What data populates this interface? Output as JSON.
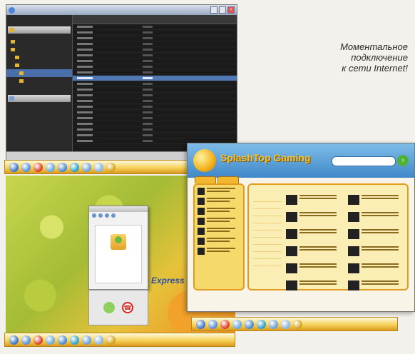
{
  "tagline": {
    "line1": "Моментальное",
    "line2": "подключение",
    "line3": "к сети Internet!"
  },
  "games": {
    "title": "SplashTop Gaming"
  },
  "desktop": {
    "brand_text": "Express G"
  },
  "dock_icon_colors": [
    "#3a76c9",
    "#5a8fd8",
    "#d8402a",
    "#6aa8e0",
    "#4b87cf",
    "#2fa0c8",
    "#6b9fd9",
    "#8ab4e4",
    "#d4a21d"
  ]
}
